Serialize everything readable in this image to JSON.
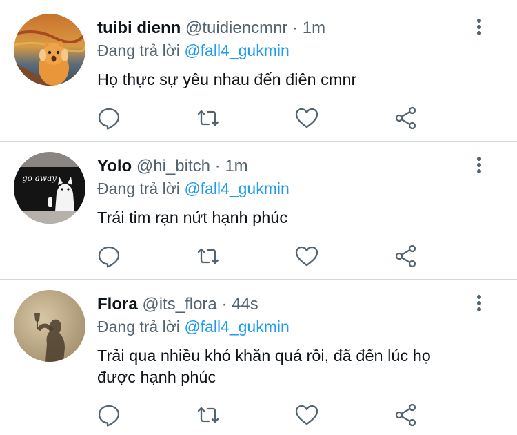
{
  "reply_prefix": "Đang trả lời",
  "tweets": [
    {
      "name": "tuibi dienn",
      "handle": "@tuidiencmnr",
      "time": "1m",
      "reply_to": "@fall4_gukmin",
      "text": "Họ thực sự yêu nhau đến điên cmnr",
      "avatar": "scream-cat-avatar"
    },
    {
      "name": "Yolo",
      "handle": "@hi_bitch",
      "time": "1m",
      "reply_to": "@fall4_gukmin",
      "text": "Trái tim rạn nứt hạnh phúc",
      "avatar": "go-away-cat-avatar",
      "avatar_text": "go away"
    },
    {
      "name": "Flora",
      "handle": "@its_flora",
      "time": "44s",
      "reply_to": "@fall4_gukmin",
      "text_line1": "Trải qua nhiều khó khăn quá rồi, đã đến lúc họ",
      "text_line2": "được hạnh phúc",
      "avatar": "shadow-wineglass-avatar"
    }
  ],
  "colors": {
    "text": "#0f1419",
    "secondary": "#536471",
    "link": "#1d9bf0",
    "divider": "#cfd9de"
  },
  "icons": [
    "reply-icon",
    "retweet-icon",
    "like-icon",
    "share-icon",
    "more-options-icon"
  ]
}
